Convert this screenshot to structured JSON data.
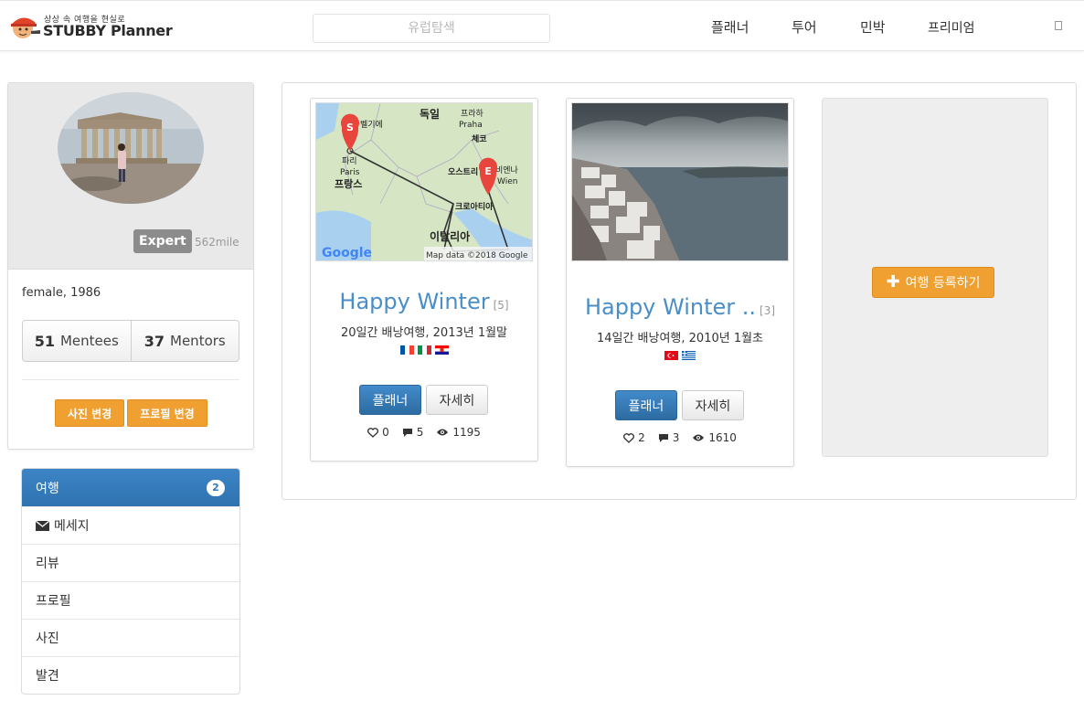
{
  "header": {
    "logo_tagline": "상상 속 여행을 현실로",
    "logo_text": "STUBBY Planner",
    "search_placeholder": "유럽탐색",
    "nav": [
      "플래너",
      "투어",
      "민박",
      "프리미엄"
    ]
  },
  "profile": {
    "badge": "Expert",
    "mileage": "562mile",
    "info": "female, 1986",
    "mentees_count": "51",
    "mentees_label": "Mentees",
    "mentors_count": "37",
    "mentors_label": "Mentors",
    "btn_photo": "사진 변경",
    "btn_profile": "프로필 변경"
  },
  "side_menu": {
    "items": [
      {
        "label": "여행",
        "count": "2"
      },
      {
        "label": "메세지"
      },
      {
        "label": "리뷰"
      },
      {
        "label": "프로필"
      },
      {
        "label": "사진"
      },
      {
        "label": "발견"
      }
    ]
  },
  "trips": [
    {
      "title": "Happy Winter",
      "count": "[5]",
      "subtitle": "20일간 배낭여행, 2013년 1월말",
      "flags": [
        "france-flag",
        "italy-flag",
        "croatia-flag"
      ],
      "btn_planner": "플래너",
      "btn_detail": "자세히",
      "likes": "0",
      "comments": "5",
      "views": "1195",
      "map": {
        "labels": [
          "벨기에",
          "독일",
          "프라하",
          "Praha",
          "체코",
          "파리",
          "Paris",
          "오스트리",
          "비엔나",
          "Wien",
          "프랑스",
          "크로아티아",
          "이탈리아"
        ],
        "start_marker": "S",
        "end_marker": "E",
        "attribution": "Map data ©2018 Google",
        "brand": "Google"
      }
    },
    {
      "title": "Happy Winter ..",
      "count": "[3]",
      "subtitle": "14일간 배낭여행, 2010년 1월초",
      "flags": [
        "turkey-flag",
        "greece-flag"
      ],
      "btn_planner": "플래너",
      "btn_detail": "자세히",
      "likes": "2",
      "comments": "3",
      "views": "1610"
    }
  ],
  "add_trip_label": "여행 등록하기",
  "colors": {
    "accent_blue": "#337ab7",
    "title_blue": "#4a8ec8",
    "orange": "#f0a030"
  }
}
